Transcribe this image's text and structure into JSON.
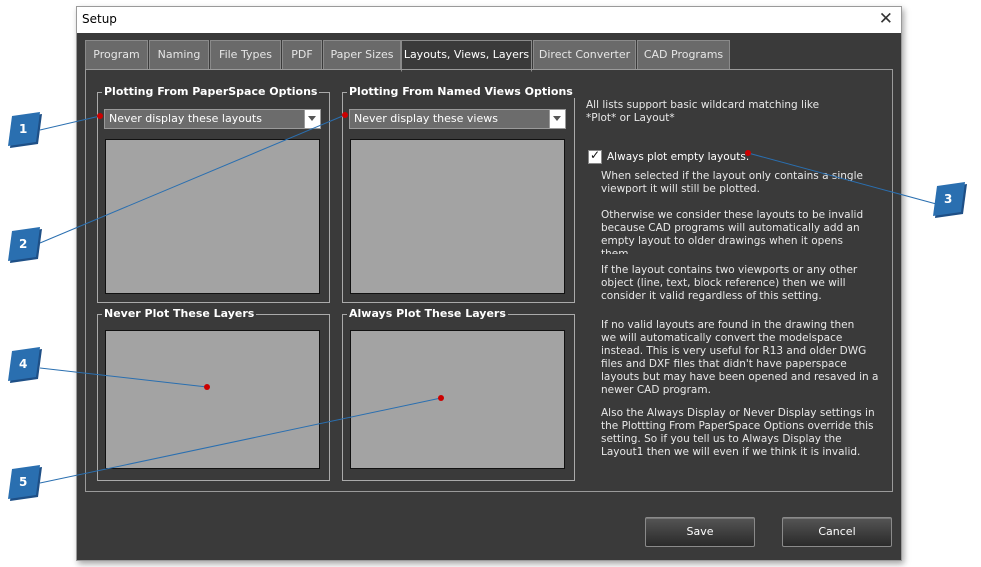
{
  "window": {
    "title": "Setup",
    "close_glyph": "✕"
  },
  "tabs": [
    {
      "label": "Program"
    },
    {
      "label": "Naming"
    },
    {
      "label": "File Types"
    },
    {
      "label": "PDF"
    },
    {
      "label": "Paper Sizes"
    },
    {
      "label": "Layouts, Views, Layers"
    },
    {
      "label": "Direct Converter"
    },
    {
      "label": "CAD Programs"
    }
  ],
  "active_tab": "Layouts, Views, Layers",
  "groups": {
    "paperspace": {
      "title": "Plotting From PaperSpace Options",
      "combo_value": "Never display these layouts"
    },
    "named_views": {
      "title": "Plotting From Named Views Options",
      "combo_value": "Never display these views"
    },
    "never_layers": {
      "title": "Never Plot These Layers"
    },
    "always_layers": {
      "title": "Always Plot These Layers"
    }
  },
  "info": {
    "wildcard_note": "All lists support basic wildcard matching like\n*Plot* or Layout*",
    "checkbox_label": "Always plot empty layouts.",
    "checkbox_checked": true,
    "desc_1": "When selected if the layout only contains a single\nviewport it will still be plotted.\n\nOtherwise we consider these layouts to be invalid\nbecause CAD programs will automatically add an\nempty layout to older drawings when it opens\nthem",
    "desc_2": "If the layout contains two viewports or any other\nobject (line, text, block reference) then we will\nconsider it valid regardless of this setting.",
    "desc_3": "If no valid layouts are found in the drawing then\nwe will automatically convert the modelspace\ninstead.  This is very useful for R13 and older DWG\nfiles and DXF files that didn't have paperspace\nlayouts but may have been opened and resaved in a\nnewer CAD program.",
    "desc_4": "Also the Always Display or Never Display settings in\nthe Plottting From PaperSpace Options override this\nsetting.  So if you tell us to Always Display the\nLayout1 then we will even if we think it is invalid."
  },
  "buttons": {
    "save": "Save",
    "cancel": "Cancel"
  },
  "callouts": [
    "1",
    "2",
    "3",
    "4",
    "5"
  ],
  "colors": {
    "callout_blue": "#2a6fb0",
    "pointer_red": "#cc0000",
    "dialog_bg": "#3a3a3a"
  }
}
